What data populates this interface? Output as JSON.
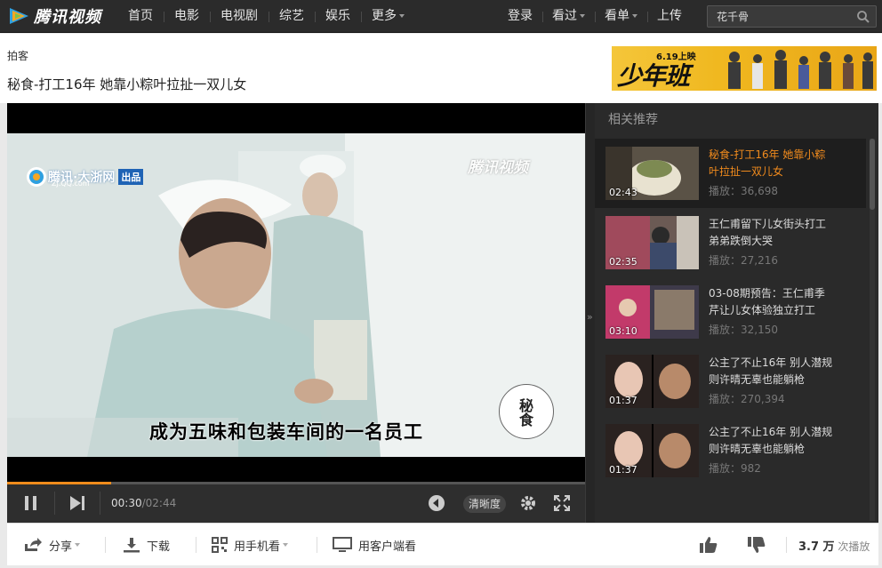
{
  "brand": {
    "logo_text": "腾讯视频"
  },
  "nav": {
    "items": [
      {
        "label": "首页"
      },
      {
        "label": "电影"
      },
      {
        "label": "电视剧"
      },
      {
        "label": "综艺"
      },
      {
        "label": "娱乐"
      },
      {
        "label": "更多"
      }
    ],
    "right": [
      {
        "label": "登录"
      },
      {
        "label": "看过"
      },
      {
        "label": "看单"
      },
      {
        "label": "上传"
      }
    ],
    "search_value": "花千骨"
  },
  "page": {
    "crumb": "拍客",
    "title": "秘食-打工16年 她靠小粽叶拉扯一双儿女"
  },
  "banner": {
    "date": "6.19上映",
    "title": "少年班"
  },
  "player": {
    "subtitle": "成为五味和包装车间的一名员工",
    "watermark_left": "腾讯·大浙网",
    "watermark_left_sub": "ZJ.QQ.com",
    "watermark_left_badge": "出品",
    "watermark_right": "腾讯视频",
    "seal_text": "秘食",
    "current_time": "00:30",
    "total_time": "/02:44",
    "progress": 0.18,
    "quality_label": "清晰度"
  },
  "sidebar": {
    "title": "相关推荐",
    "items": [
      {
        "title": "秘食-打工16年 她靠小粽叶拉扯一双儿女",
        "plays": "播放：36,698",
        "duration": "02:43",
        "active": true
      },
      {
        "title": "王仁甫留下儿女街头打工 弟弟跌倒大哭",
        "plays": "播放：27,216",
        "duration": "02:35",
        "active": false
      },
      {
        "title": "03-08期预告：王仁甫季芹让儿女体验独立打工",
        "plays": "播放：32,150",
        "duration": "03:10",
        "active": false
      },
      {
        "title": "公主了不止16年 别人潜规则许晴无辜也能躺枪",
        "plays": "播放：270,394",
        "duration": "01:37",
        "active": false
      },
      {
        "title": "公主了不止16年 别人潜规则许晴无辜也能躺枪",
        "plays": "播放：982",
        "duration": "01:37",
        "active": false
      }
    ]
  },
  "bottom": {
    "share": "分享",
    "download": "下载",
    "mobile": "用手机看",
    "client": "用客户端看",
    "play_count": "3.7 万",
    "play_count_suffix": "次播放"
  },
  "colors": {
    "accent": "#f18b1d",
    "nav_bg": "#2b2b2b",
    "sidebar_bg": "#2a2a2a"
  }
}
